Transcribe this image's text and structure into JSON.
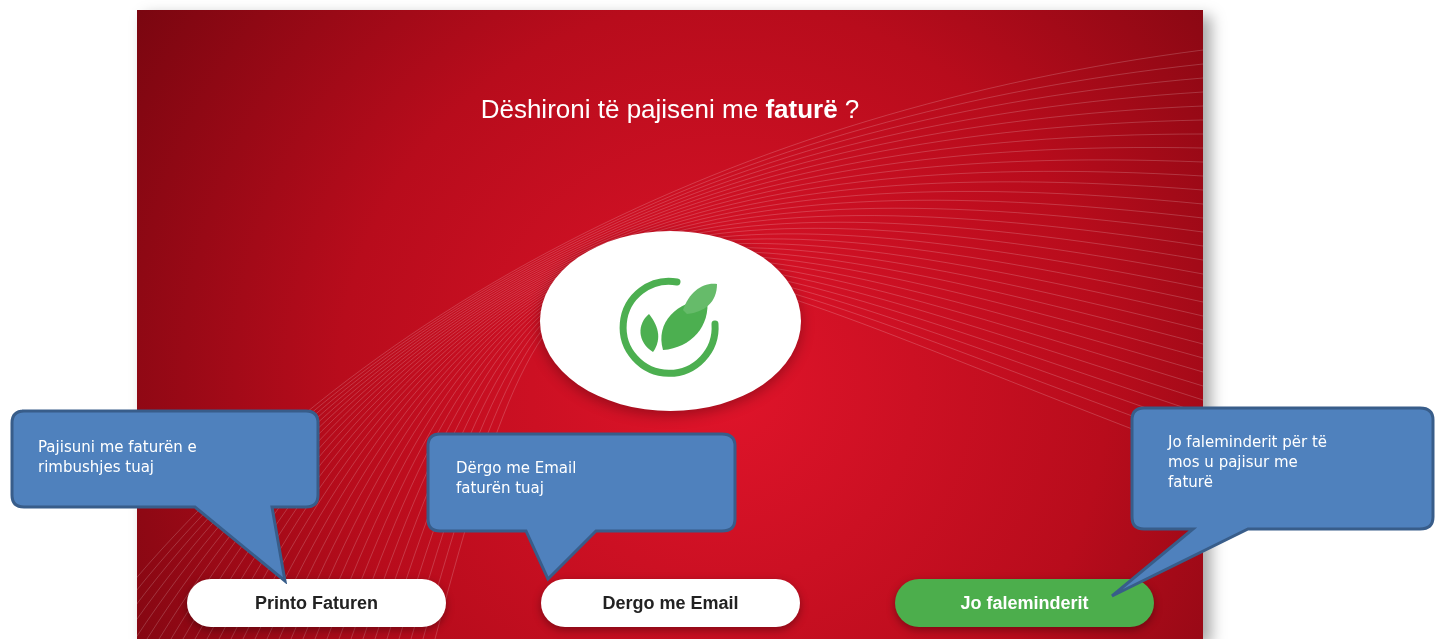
{
  "screen": {
    "title": "Dëshironi të pajiseni me **faturë** ?",
    "buttons": [
      {
        "label": "Printo Faturen",
        "kind": "outline"
      },
      {
        "label": "Dergo me Email",
        "kind": "outline"
      },
      {
        "label": "Jo faleminderit",
        "kind": "primary"
      }
    ]
  },
  "callouts": [
    {
      "text": "Pajisuni me faturën e\nrimbushjes tuaj"
    },
    {
      "text": "Dërgo me Email\nfaturën tuaj"
    },
    {
      "text": "Jo faleminderit për të\nmos u pajisur me\nfaturë"
    }
  ]
}
